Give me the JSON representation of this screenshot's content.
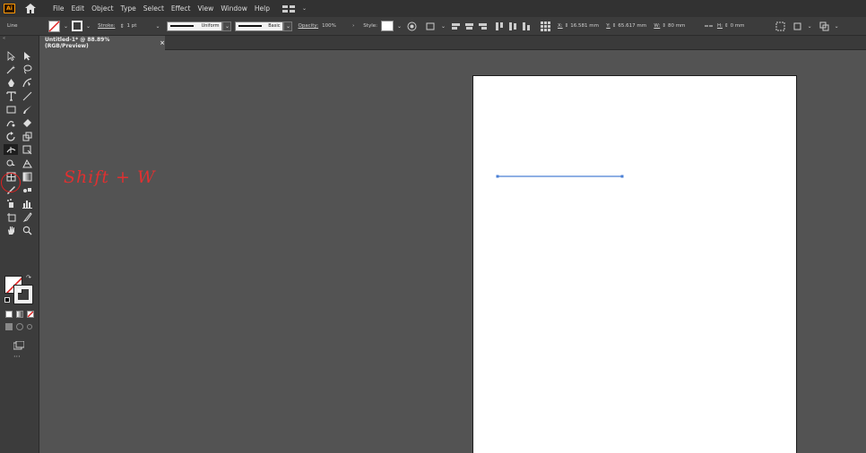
{
  "menubar": {
    "app_logo": "Ai",
    "items": [
      "File",
      "Edit",
      "Object",
      "Type",
      "Select",
      "Effect",
      "View",
      "Window",
      "Help"
    ]
  },
  "controlbar": {
    "selection_label": "Line",
    "stroke_label": "Stroke:",
    "stroke_weight": "1 pt",
    "profile_label": "Uniform",
    "brush_label": "Basic",
    "opacity_label": "Opacity:",
    "opacity_value": "100%",
    "style_label": "Style:",
    "x_label": "X:",
    "x_value": "16.581 mm",
    "y_label": "Y:",
    "y_value": "65.617 mm",
    "w_label": "W:",
    "w_value": "80 mm",
    "h_label": "H:",
    "h_value": "0 mm"
  },
  "document": {
    "tab_title": "Untitled-1* @ 88.89% (RGB/Preview)",
    "close_glyph": "×"
  },
  "annotation": {
    "text": "Shift + W",
    "color": "#e03030"
  },
  "colors": {
    "accent": "#ff9a00",
    "selected_line": "#4a7fd4",
    "highlight": "#e02020"
  },
  "toolbar": {
    "more_tools": "···"
  }
}
